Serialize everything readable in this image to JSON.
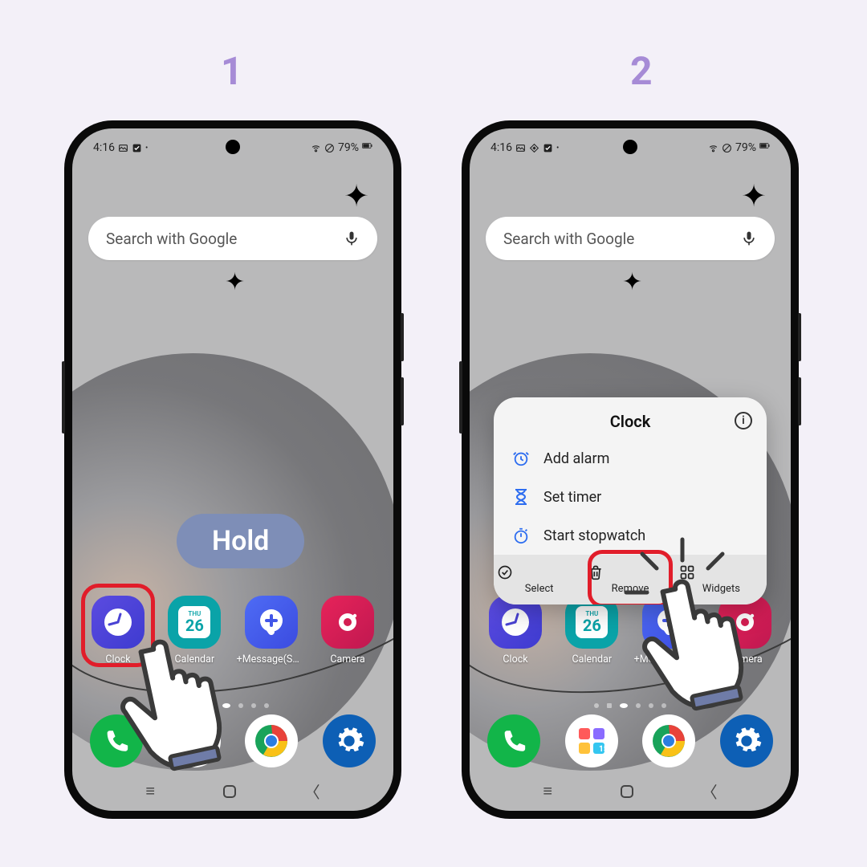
{
  "steps": {
    "one": "1",
    "two": "2"
  },
  "status": {
    "time": "4:16",
    "battery": "79%"
  },
  "search": {
    "placeholder": "Search with Google"
  },
  "hold_label": "Hold",
  "apps1": [
    {
      "label": "Clock"
    },
    {
      "label": "Calendar",
      "day": "26",
      "eyebrow": "THU"
    },
    {
      "label": "+Message(SM…"
    },
    {
      "label": "Camera"
    }
  ],
  "apps2": [
    {
      "label": "Clock"
    },
    {
      "label": "Calendar",
      "day": "26",
      "eyebrow": "THU"
    },
    {
      "label": "+Message(SM…"
    },
    {
      "label": "Camera"
    }
  ],
  "popup": {
    "title": "Clock",
    "items": [
      {
        "label": "Add alarm"
      },
      {
        "label": "Set timer"
      },
      {
        "label": "Start stopwatch"
      }
    ],
    "footer": [
      {
        "label": "Select"
      },
      {
        "label": "Remove"
      },
      {
        "label": "Widgets"
      }
    ]
  }
}
